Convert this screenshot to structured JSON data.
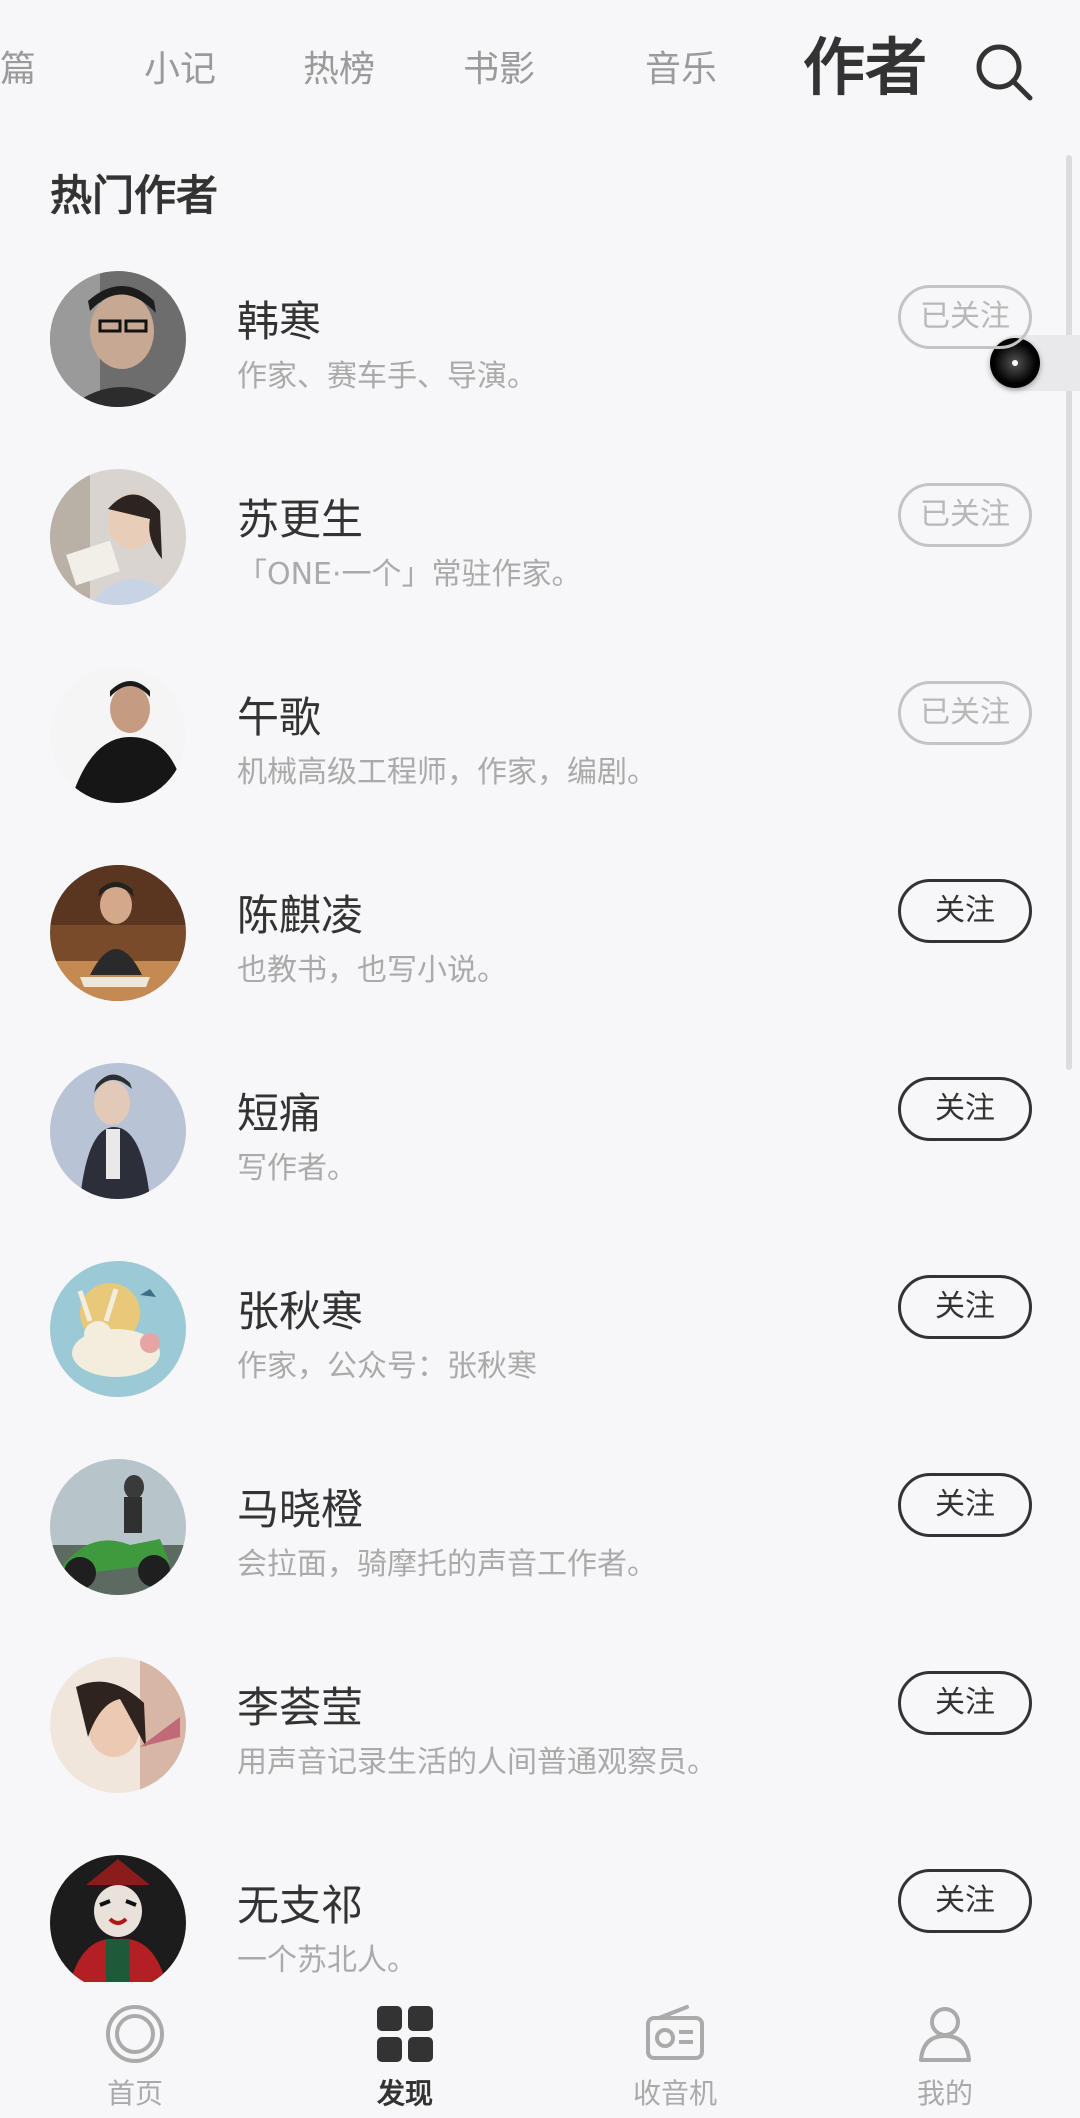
{
  "tabs": [
    {
      "label": "长篇",
      "active": false
    },
    {
      "label": "小记",
      "active": false
    },
    {
      "label": "热榜",
      "active": false
    },
    {
      "label": "书影",
      "active": false
    },
    {
      "label": "音乐",
      "active": false
    },
    {
      "label": "作者",
      "active": true
    }
  ],
  "section_title": "热门作者",
  "authors": [
    {
      "name": "韩寒",
      "desc": "作家、赛车手、导演。",
      "button": "已关注",
      "followed": true
    },
    {
      "name": "苏更生",
      "desc": "「ONE·一个」常驻作家。",
      "button": "已关注",
      "followed": true
    },
    {
      "name": "午歌",
      "desc": "机械高级工程师，作家，编剧。",
      "button": "已关注",
      "followed": true
    },
    {
      "name": "陈麒凌",
      "desc": "也教书，也写小说。",
      "button": "关注",
      "followed": false
    },
    {
      "name": "短痛",
      "desc": "写作者。",
      "button": "关注",
      "followed": false
    },
    {
      "name": "张秋寒",
      "desc": "作家，公众号：张秋寒",
      "button": "关注",
      "followed": false
    },
    {
      "name": "马晓橙",
      "desc": "会拉面，骑摩托的声音工作者。",
      "button": "关注",
      "followed": false
    },
    {
      "name": "李荟莹",
      "desc": "用声音记录生活的人间普通观察员。",
      "button": "关注",
      "followed": false
    },
    {
      "name": "无支祁",
      "desc": "一个苏北人。",
      "button": "关注",
      "followed": false
    }
  ],
  "bottom_nav": [
    {
      "label": "首页",
      "icon": "home-ring-icon",
      "active": false
    },
    {
      "label": "发现",
      "icon": "grid-icon",
      "active": true
    },
    {
      "label": "收音机",
      "icon": "radio-icon",
      "active": false
    },
    {
      "label": "我的",
      "icon": "person-icon",
      "active": false
    }
  ],
  "colors": {
    "background": "#f7f7f9",
    "text_primary": "#333333",
    "text_secondary": "#aaaaaa",
    "followed_border": "#c4c4c4"
  }
}
